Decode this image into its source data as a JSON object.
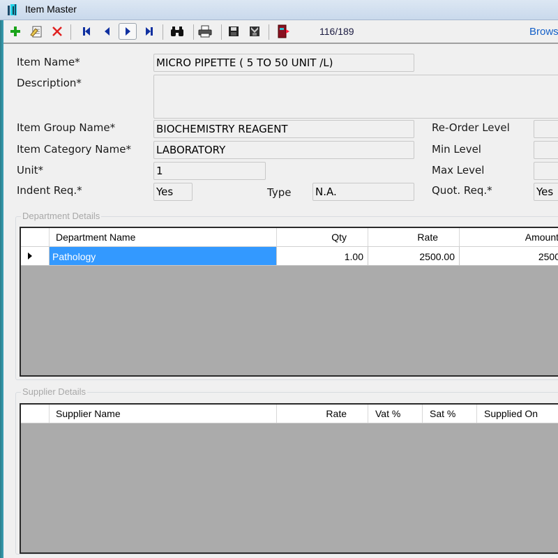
{
  "window": {
    "title": "Item Master"
  },
  "toolbar": {
    "buttons": [
      {
        "name": "add",
        "icon": "plus-icon"
      },
      {
        "name": "edit",
        "icon": "edit-document-icon"
      },
      {
        "name": "delete",
        "icon": "delete-x-icon"
      },
      {
        "name": "first",
        "icon": "first-record-icon"
      },
      {
        "name": "previous",
        "icon": "previous-record-icon"
      },
      {
        "name": "next",
        "icon": "next-record-icon"
      },
      {
        "name": "last",
        "icon": "last-record-icon"
      },
      {
        "name": "find",
        "icon": "binoculars-icon"
      },
      {
        "name": "print",
        "icon": "printer-icon"
      },
      {
        "name": "save",
        "icon": "floppy-save-icon"
      },
      {
        "name": "cancel-save",
        "icon": "floppy-cancel-icon"
      },
      {
        "name": "exit",
        "icon": "exit-door-icon"
      }
    ],
    "record_count": "116/189",
    "browse_label": "Browse"
  },
  "form": {
    "item_name": {
      "label": "Item Name*",
      "value": "MICRO PIPETTE ( 5 TO 50 UNIT /L)"
    },
    "description": {
      "label": "Description*",
      "value": ""
    },
    "item_group_name": {
      "label": "Item Group Name*",
      "value": "BIOCHEMISTRY REAGENT"
    },
    "item_category_name": {
      "label": "Item Category Name*",
      "value": "LABORATORY"
    },
    "unit": {
      "label": "Unit*",
      "value": "1"
    },
    "indent_req": {
      "label": "Indent Req.*",
      "value": "Yes"
    },
    "type": {
      "label": "Type",
      "value": "N.A."
    },
    "reorder_level": {
      "label": "Re-Order Level",
      "value": ""
    },
    "min_level": {
      "label": "Min Level",
      "value": ""
    },
    "max_level": {
      "label": "Max Level",
      "value": ""
    },
    "quot_req": {
      "label": "Quot. Req.*",
      "value": "Yes"
    }
  },
  "department_details": {
    "title": "Department Details",
    "columns": [
      "Department Name",
      "Qty",
      "Rate",
      "Amount"
    ],
    "rows": [
      {
        "department_name": "Pathology",
        "qty": "1.00",
        "rate": "2500.00",
        "amount": "2500"
      }
    ]
  },
  "supplier_details": {
    "title": "Supplier Details",
    "columns": [
      "Supplier Name",
      "Rate",
      "Vat %",
      "Sat %",
      "Supplied On"
    ],
    "rows": []
  }
}
